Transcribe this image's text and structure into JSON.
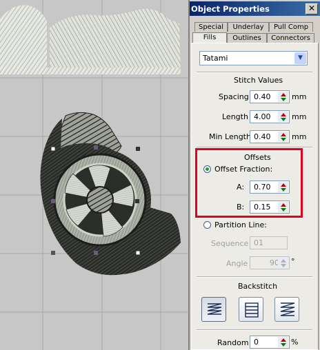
{
  "panel": {
    "title": "Object Properties",
    "close_label": "✕",
    "tabs_row1": [
      "Special",
      "Underlay",
      "Pull Comp"
    ],
    "tabs_row2": [
      "Fills",
      "Outlines",
      "Connectors"
    ],
    "active_tab": "Fills",
    "fill_type": "Tatami",
    "stitch_values": {
      "heading": "Stitch Values",
      "spacing_label": "Spacing",
      "spacing_value": "0.40",
      "length_label": "Length",
      "length_value": "4.00",
      "min_length_label": "Min Length",
      "min_length_value": "0.40",
      "unit": "mm"
    },
    "offsets": {
      "heading": "Offsets",
      "offset_fraction_label": "Offset Fraction:",
      "a_label": "A:",
      "a_value": "0.70",
      "b_label": "B:",
      "b_value": "0.15",
      "partition_line_label": "Partition Line:",
      "sequence_label": "Sequence",
      "sequence_value": "01",
      "angle_label": "Angle",
      "angle_value": "90.",
      "angle_unit": "°"
    },
    "backstitch": {
      "heading": "Backstitch"
    },
    "random": {
      "label": "Random",
      "value": "0",
      "unit": "%"
    }
  },
  "colors": {
    "title_bar": "#0a246a",
    "highlight_box": "#e3001b",
    "spin_up": "#c00000",
    "spin_down": "#008000",
    "radio_selected": "#21a121"
  }
}
